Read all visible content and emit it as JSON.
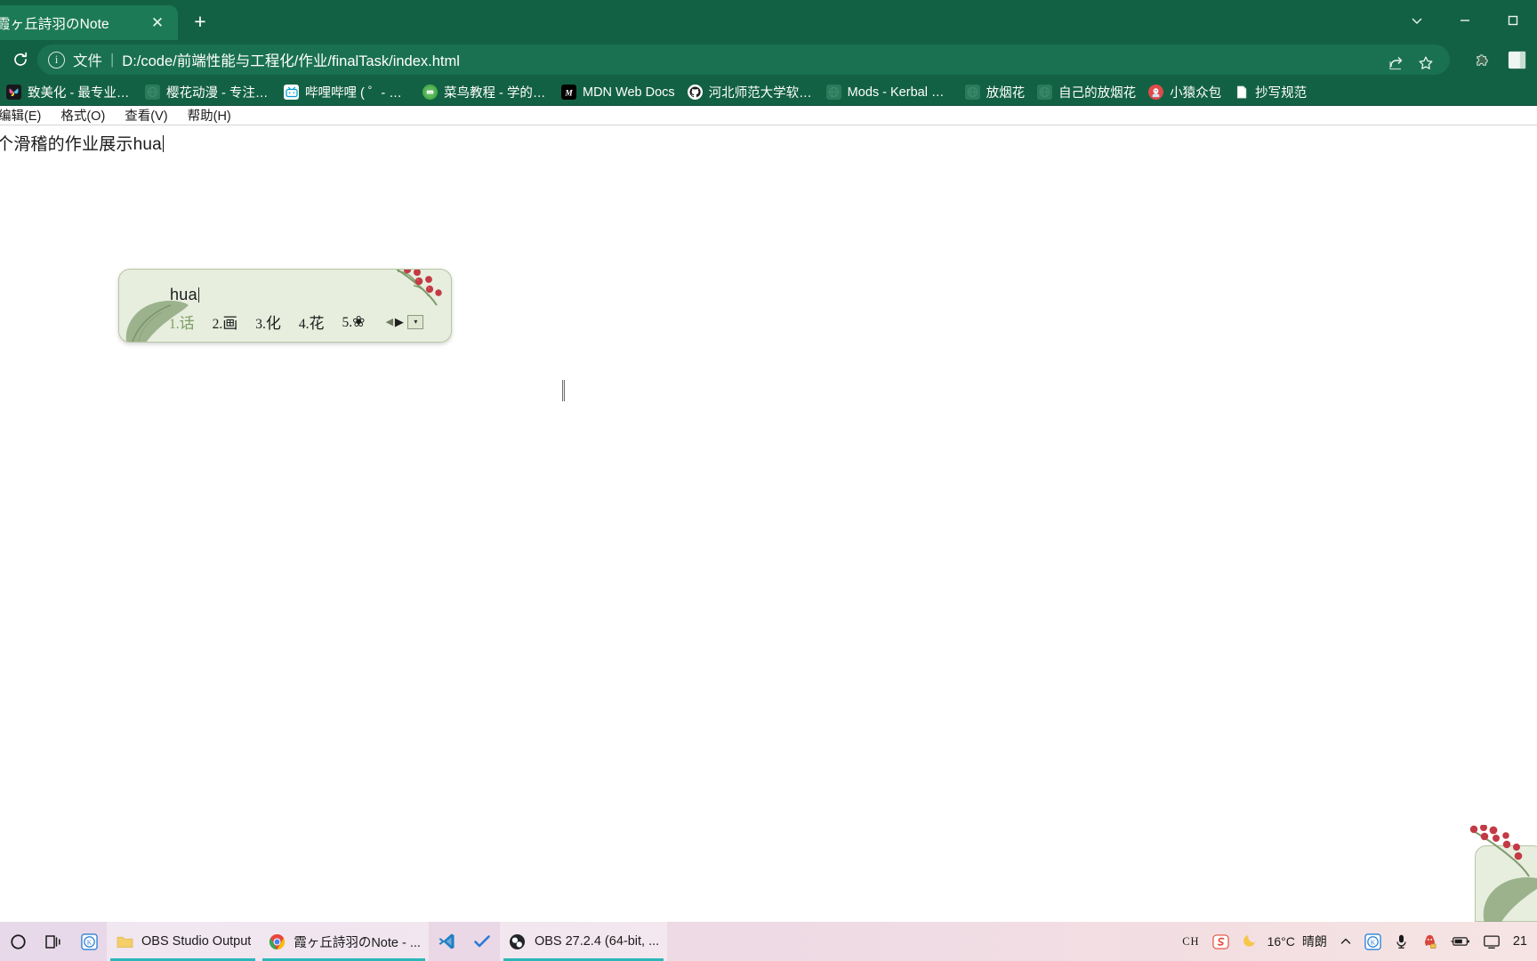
{
  "browser": {
    "tab": {
      "title": "霞ヶ丘詩羽のNote",
      "close_icon": "close-icon"
    },
    "newtab_label": "+",
    "window_controls": {
      "more": "chevron-down-icon",
      "minimize": "minimize-icon",
      "maximize": "maximize-icon"
    },
    "toolbar": {
      "reload_label": "reload-icon",
      "scheme_label": "文件",
      "divider": "|",
      "url": "D:/code/前端性能与工程化/作业/finalTask/index.html",
      "share_icon": "share-icon",
      "bookmark_icon": "star-icon",
      "extensions_icon": "puzzle-icon",
      "profile_icon": "profile-icon"
    },
    "bookmarks": [
      {
        "label": "致美化 - 最专业的...",
        "icon": "butterfly-icon",
        "color": "#17181c"
      },
      {
        "label": "樱花动漫 - 专注动...",
        "icon": "globe-icon",
        "color": "#2a7a5c"
      },
      {
        "label": "哔哩哔哩 ( ゜- ゜)つ...",
        "icon": "bilibili-icon",
        "color": "#ffffff"
      },
      {
        "label": "菜鸟教程 - 学的不...",
        "icon": "runoob-icon",
        "color": "#4cae4c"
      },
      {
        "label": "MDN Web Docs",
        "icon": "mdn-icon",
        "color": "#000000"
      },
      {
        "label": "河北师范大学软件...",
        "icon": "github-icon",
        "color": "#ffffff"
      },
      {
        "label": "Mods - Kerbal Sp...",
        "icon": "globe-icon",
        "color": "#2a7a5c"
      },
      {
        "label": "放烟花",
        "icon": "globe-icon",
        "color": "#2a7a5c"
      },
      {
        "label": "自己的放烟花",
        "icon": "globe-icon",
        "color": "#2a7a5c"
      },
      {
        "label": "小猿众包",
        "icon": "xiaoyuan-icon",
        "color": "#e34a4a"
      },
      {
        "label": "抄写规范",
        "icon": "doc-icon",
        "color": "#ffffff"
      }
    ]
  },
  "app": {
    "menus": [
      {
        "label": "编辑(E)"
      },
      {
        "label": "格式(O)"
      },
      {
        "label": "查看(V)"
      },
      {
        "label": "帮助(H)"
      }
    ],
    "note_text": "个滑稽的作业展示hua"
  },
  "ime": {
    "composition": "hua",
    "candidates": [
      {
        "num": "1.",
        "text": "话",
        "selected": true
      },
      {
        "num": "2.",
        "text": "画",
        "selected": false
      },
      {
        "num": "3.",
        "text": "化",
        "selected": false
      },
      {
        "num": "4.",
        "text": "花",
        "selected": false
      },
      {
        "num": "5.",
        "text": "❀",
        "selected": false
      }
    ],
    "prev_label": "◀",
    "next_label": "▶",
    "more_label": "▾",
    "bg_color": "#e7eede",
    "border_color": "#b7c6a4",
    "selected_color": "#7d9d62"
  },
  "taskbar": {
    "start_label": "start-icon",
    "taskview_label": "task-view-icon",
    "pinned": [
      {
        "label": "",
        "icon": "kingsoft-icon",
        "active": false
      }
    ],
    "items": [
      {
        "label": "OBS Studio Output",
        "icon": "folder-icon",
        "active": true
      },
      {
        "label": "霞ヶ丘詩羽のNote - ...",
        "icon": "chrome-icon",
        "active": true
      },
      {
        "label": "",
        "icon": "vscode-icon",
        "active": false
      },
      {
        "label": "",
        "icon": "todo-check-icon",
        "active": false
      },
      {
        "label": "OBS 27.2.4 (64-bit, ...",
        "icon": "obs-icon",
        "active": true
      }
    ],
    "tray": {
      "ime_label": "CH",
      "sogou_icon": "sogou-icon",
      "weather_icon": "moon-icon",
      "weather_temp": "16°C",
      "weather_desc": "晴朗",
      "overflow_label": "^",
      "icons": [
        {
          "name": "kingsoft-icon"
        },
        {
          "name": "microphone-icon"
        },
        {
          "name": "qq-icon"
        },
        {
          "name": "battery-icon"
        },
        {
          "name": "display-icon"
        }
      ],
      "clock": "21"
    }
  }
}
